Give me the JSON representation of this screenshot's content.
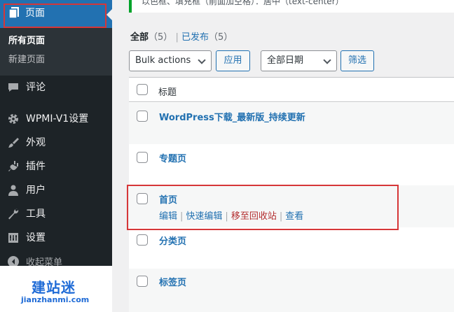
{
  "sidebar": {
    "pages_label": "页面",
    "submenu": {
      "all_pages": "所有页面",
      "add_new": "新建页面"
    },
    "items": [
      {
        "label": "评论",
        "icon": "comment-icon"
      },
      {
        "label": "WPMI-V1设置",
        "icon": "gear-icon"
      },
      {
        "label": "外观",
        "icon": "paintbrush-icon"
      },
      {
        "label": "插件",
        "icon": "plugin-icon"
      },
      {
        "label": "用户",
        "icon": "user-icon"
      },
      {
        "label": "工具",
        "icon": "wrench-icon"
      },
      {
        "label": "设置",
        "icon": "settings-icon"
      }
    ],
    "collapse_label": "收起菜单"
  },
  "watermark": {
    "title": "建站迷",
    "url": "jianzhanmi.com"
  },
  "notice": {
    "text": "以色框、填充框（前面加空格）：居中（text-center）"
  },
  "filters": {
    "all_label": "全部",
    "all_count": "（5）",
    "separator": "|",
    "published_label": "已发布",
    "published_count": "（5）"
  },
  "toolbar": {
    "bulk_actions": "Bulk actions",
    "apply": "应用",
    "all_dates": "全部日期",
    "filter": "筛选"
  },
  "table": {
    "title_header": "标题",
    "rows": [
      {
        "title": "WordPress下载_最新版_持续更新"
      },
      {
        "title": "专题页"
      },
      {
        "title": "首页"
      },
      {
        "title": "分类页"
      },
      {
        "title": "标签页"
      }
    ],
    "row_actions": {
      "edit": "编辑",
      "quick_edit": "快速编辑",
      "trash": "移至回收站",
      "view": "查看",
      "sep": "|"
    }
  },
  "colors": {
    "sidebar_bg": "#1d2327",
    "active_menu": "#2271b1",
    "link": "#2271b1",
    "trash": "#b32d2e",
    "highlight": "#d63638",
    "watermark": "#1f6bd6"
  }
}
